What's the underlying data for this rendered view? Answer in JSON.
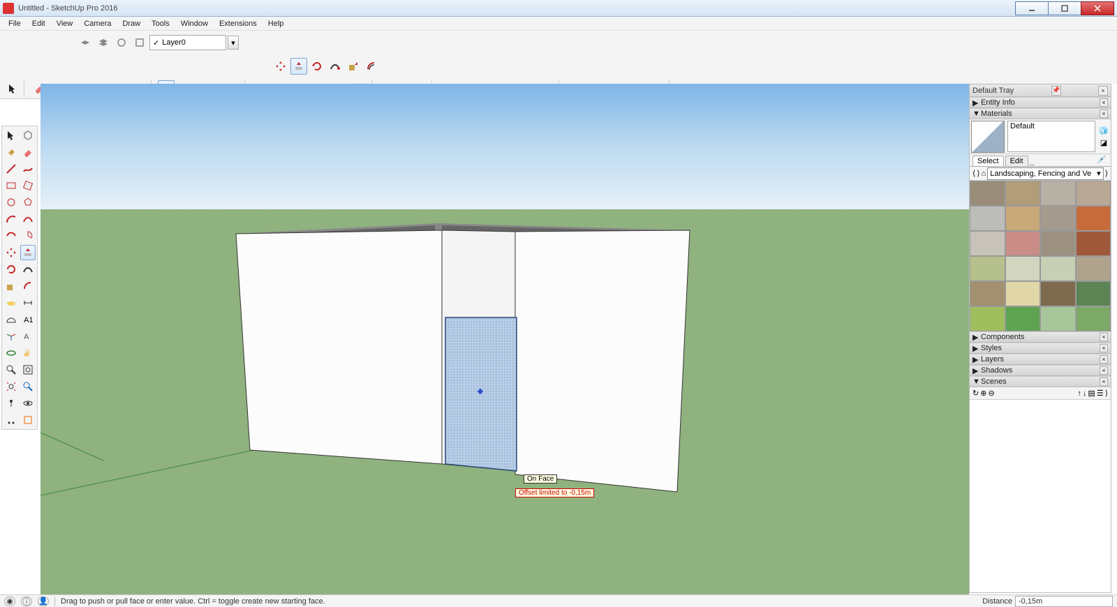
{
  "title": "Untitled - SketchUp Pro 2016",
  "menu": [
    "File",
    "Edit",
    "View",
    "Camera",
    "Draw",
    "Tools",
    "Window",
    "Extensions",
    "Help"
  ],
  "layer_selected": "Layer0",
  "tooltip_onface": "On Face",
  "tooltip_offset": "Offset limited to -0,15m",
  "tray": {
    "title": "Default Tray",
    "panels": {
      "entity_info": "Entity Info",
      "materials": "Materials",
      "components": "Components",
      "styles": "Styles",
      "layers": "Layers",
      "shadows": "Shadows",
      "scenes": "Scenes"
    },
    "material_name": "Default",
    "material_tabs": [
      "Select",
      "Edit"
    ],
    "material_lib": "Landscaping, Fencing and Ve"
  },
  "material_colors": [
    "#9a8d7a",
    "#b29d7a",
    "#b7b1a5",
    "#b9a896",
    "#bcbdb8",
    "#c9a97a",
    "#a59a8e",
    "#c76b3d",
    "#c7c3b8",
    "#c98c86",
    "#9c9180",
    "#a0583a",
    "#b6c08c",
    "#d2d6c0",
    "#c7cfb5",
    "#b0a38d",
    "#a39070",
    "#e0d6a8",
    "#7e6a4f",
    "#5c8454",
    "#9fbf5e",
    "#5ea352",
    "#a7c79a",
    "#7ca968"
  ],
  "status": {
    "hint": "Drag to push or pull face or enter value.  Ctrl = toggle create new starting face.",
    "distance_label": "Distance",
    "distance_value": "-0,15m"
  }
}
